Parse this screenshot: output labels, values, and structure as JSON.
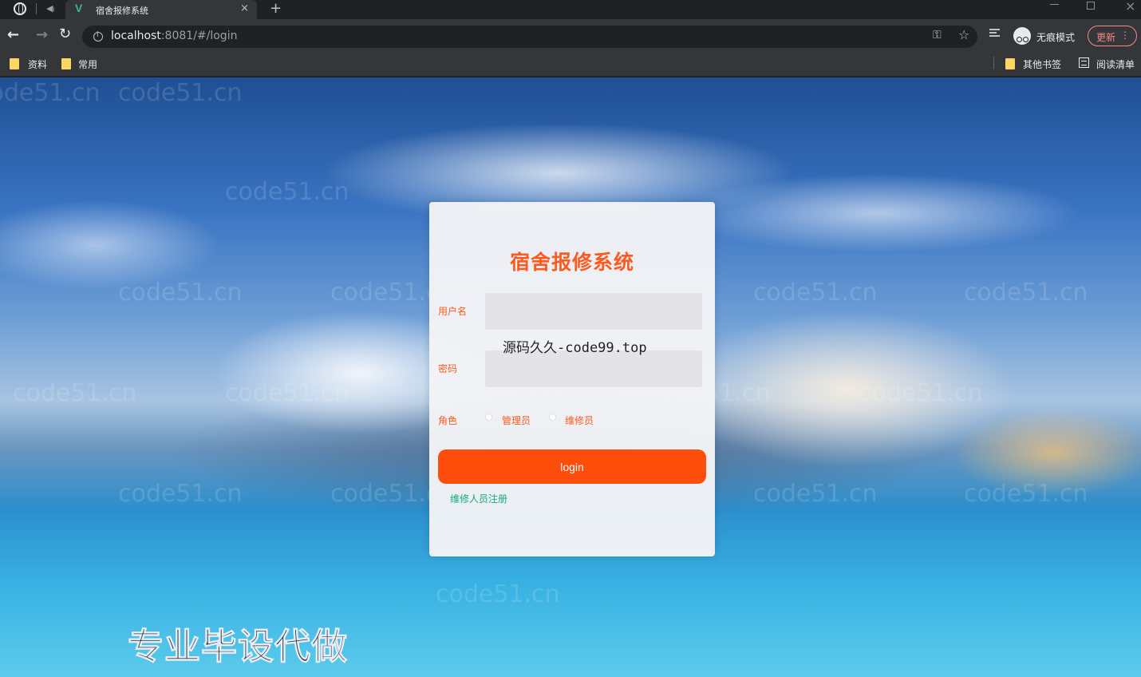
{
  "browser": {
    "tab_title": "宿舍报修系统",
    "tab_favicon": "V",
    "tab_close": "×",
    "new_tab": "+",
    "url_host": "localhost",
    "url_rest": ":8081/#/login",
    "incognito_label": "无痕模式",
    "update_label": "更新",
    "update_more": "⋮",
    "bookmarks": {
      "left": [
        "资料",
        "常用"
      ],
      "other": "其他书签",
      "reading_list": "阅读清单"
    }
  },
  "page": {
    "watermark": "code51.cn",
    "overlay_text": "源码久久-code99.top",
    "promo_text": "专业毕设代做"
  },
  "login": {
    "title": "宿舍报修系统",
    "username_label": "用户名",
    "password_label": "密码",
    "username_value": "",
    "password_value": "",
    "role_label": "角色",
    "roles": [
      "管理员",
      "维修员"
    ],
    "selected_role": null,
    "login_button": "login",
    "register_link": "维修人员注册"
  },
  "colors": {
    "accent": "#ff4e0b",
    "title": "#ff5a1f",
    "link": "#19a87a"
  }
}
